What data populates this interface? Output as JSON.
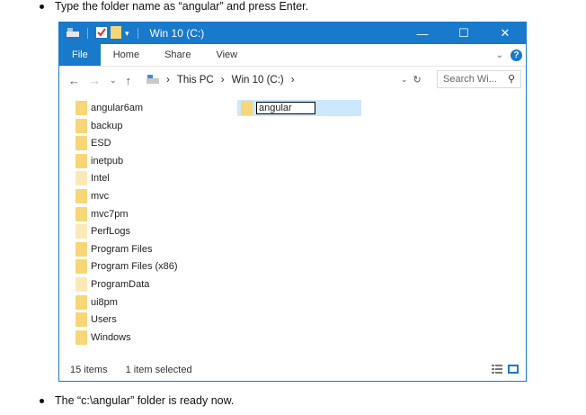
{
  "instructions": {
    "top": "Type the folder name as “angular” and press Enter.",
    "bottom": "The “c:\\angular” folder is ready now."
  },
  "window": {
    "title": "Win 10 (C:)",
    "controls": {
      "minimize": "—",
      "maximize": "☐",
      "close": "✕"
    }
  },
  "ribbon": {
    "tabs": [
      "File",
      "Home",
      "Share",
      "View"
    ]
  },
  "address": {
    "crumbs": [
      "This PC",
      "Win 10 (C:)"
    ],
    "search_placeholder": "Search Wi..."
  },
  "folders": [
    {
      "name": "angular6am",
      "light": false
    },
    {
      "name": "backup",
      "light": false
    },
    {
      "name": "ESD",
      "light": false
    },
    {
      "name": "inetpub",
      "light": false
    },
    {
      "name": "Intel",
      "light": true
    },
    {
      "name": "mvc",
      "light": false
    },
    {
      "name": "mvc7pm",
      "light": false
    },
    {
      "name": "PerfLogs",
      "light": true
    },
    {
      "name": "Program Files",
      "light": false
    },
    {
      "name": "Program Files (x86)",
      "light": false
    },
    {
      "name": "ProgramData",
      "light": true
    },
    {
      "name": "ui8pm",
      "light": false
    },
    {
      "name": "Users",
      "light": false
    },
    {
      "name": "Windows",
      "light": false
    }
  ],
  "new_folder": {
    "value": "angular"
  },
  "status": {
    "count": "15 items",
    "selected": "1 item selected"
  },
  "colors": {
    "accent": "#1979ca",
    "folder": "#f6d676",
    "selection": "#cce8ff"
  }
}
